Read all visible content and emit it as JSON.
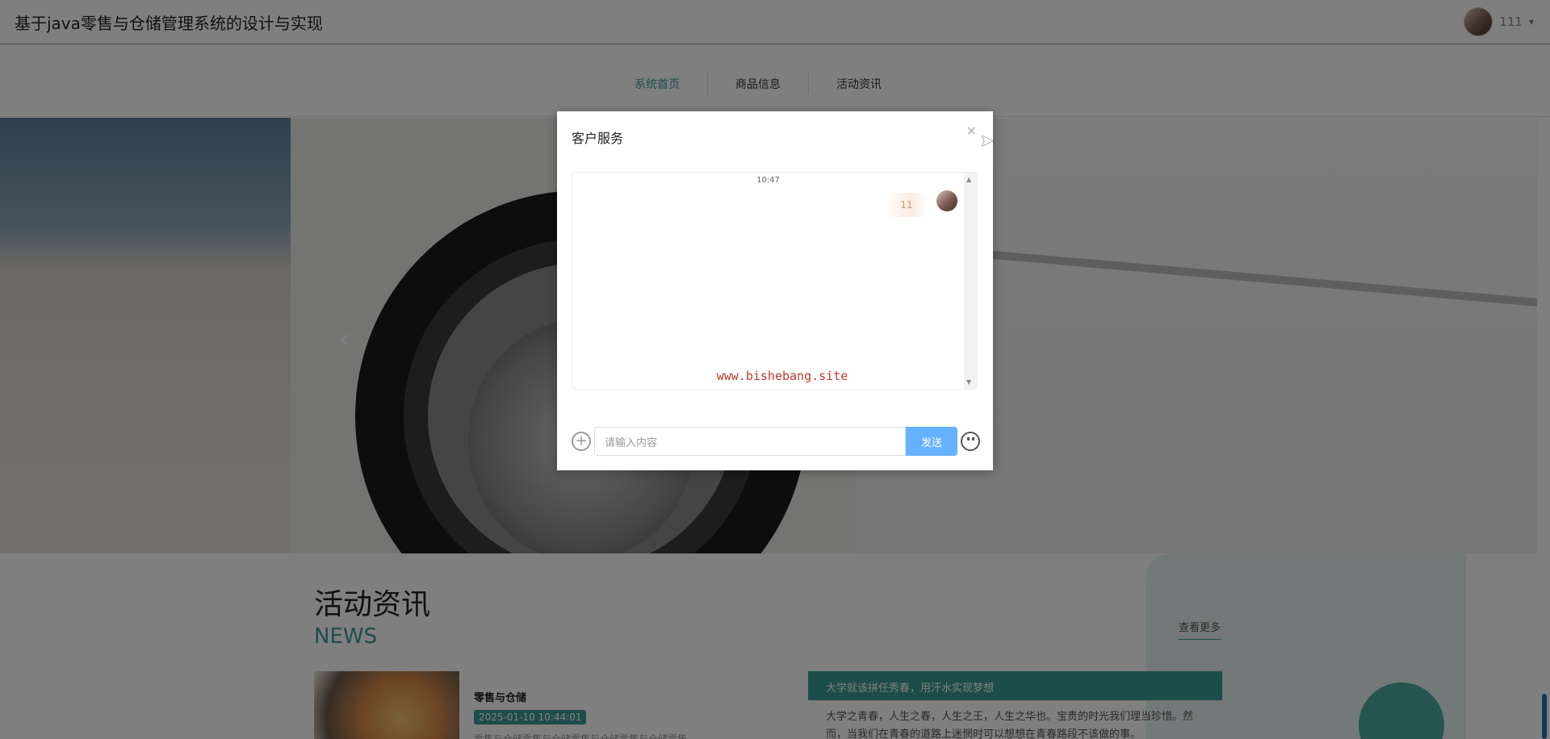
{
  "header": {
    "title": "基于java零售与仓储管理系统的设计与实现",
    "user_name": "111",
    "caret": "▾"
  },
  "nav": {
    "items": [
      {
        "label": "系统首页"
      },
      {
        "label": "商品信息"
      },
      {
        "label": "活动资讯"
      }
    ]
  },
  "banner": {
    "prev_arrow": "‹"
  },
  "news": {
    "title": "活动资讯",
    "subtitle": "NEWS",
    "view_more": "查看更多",
    "item_title": "零售与仓储",
    "item_date": "2025-01-10 10:44:01",
    "item_desc": "零售与仓储零售与仓储零售与仓储零售与仓储零售",
    "featured_title": "大学就该拼任秀春，用汗水实现梦想",
    "featured_text": "大学之青春，人生之春，人生之王，人生之华也。宝贵的时光我们理当珍惜。然而，当我们在青春的道路上迷惘时可以想想在青春路段不该做的事。"
  },
  "dialog": {
    "title": "客户服务",
    "close": "×",
    "time": "10:47",
    "message": "11",
    "watermark": "www.bishebang.site",
    "input_placeholder": "请输入内容",
    "send_label": "发送",
    "plus": "+"
  }
}
